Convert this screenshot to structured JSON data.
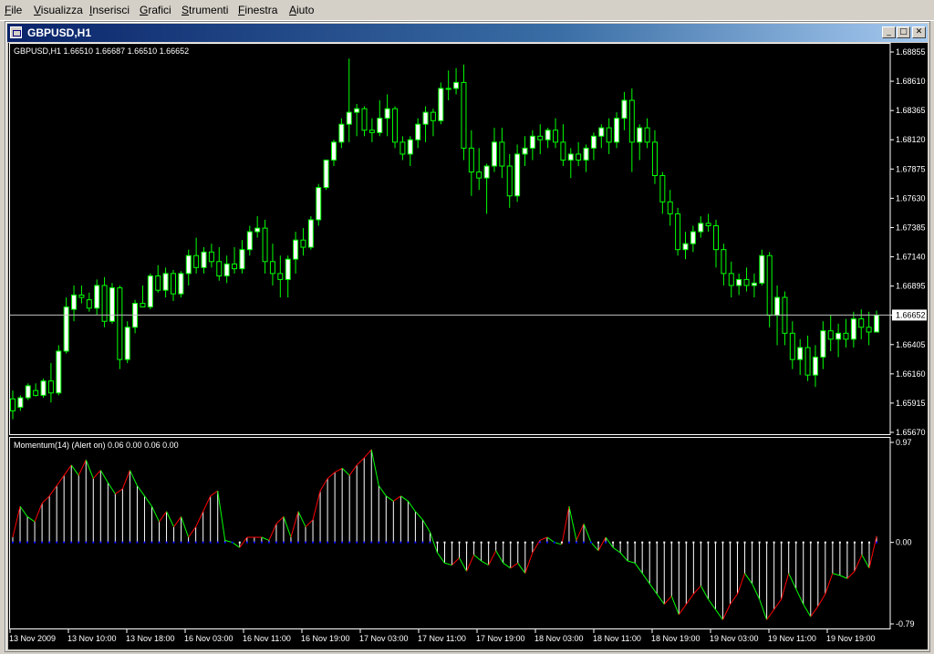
{
  "menu": [
    {
      "label": "File",
      "u": "F",
      "rest": "ile"
    },
    {
      "label": "Visualizza",
      "u": "V",
      "rest": "isualizza"
    },
    {
      "label": "Inserisci",
      "u": "I",
      "rest": "nserisci"
    },
    {
      "label": "Grafici",
      "u": "G",
      "rest": "rafici"
    },
    {
      "label": "Strumenti",
      "u": "S",
      "rest": "trumenti"
    },
    {
      "label": "Finestra",
      "u": "F",
      "rest": "inestra"
    },
    {
      "label": "Aiuto",
      "u": "A",
      "rest": "iuto"
    }
  ],
  "window": {
    "title": "GBPUSD,H1"
  },
  "colors": {
    "bull": "#00ff00",
    "bear": "#000000",
    "candle_outline": "#00ff00",
    "bull_fill": "#ffffff",
    "hline": "#c0c0c0",
    "mom_line_pos": "#ff0000",
    "mom_line_neg": "#00ff00",
    "mom_stick": "#ffffff",
    "mom_dot_pos": "#0000ff",
    "mom_dot_neg": "#ffffff"
  },
  "main_chart": {
    "header": "GBPUSD,H1  1.66510 1.66687 1.66510 1.66652",
    "price_labels": [
      "1.68855",
      "1.68610",
      "1.68365",
      "1.68120",
      "1.67875",
      "1.67630",
      "1.67385",
      "1.67140",
      "1.66895",
      "1.66652",
      "1.66405",
      "1.66160",
      "1.65915",
      "1.65670"
    ],
    "current_price": "1.66652"
  },
  "indicator": {
    "header": "Momentum(14) (Alert on) 0.06 0.00 0.06 0.00",
    "labels": [
      "0.97",
      "0.00",
      "-0.79"
    ]
  },
  "time_labels": [
    "13 Nov 2009",
    "13 Nov 10:00",
    "13 Nov 18:00",
    "16 Nov 03:00",
    "16 Nov 11:00",
    "16 Nov 19:00",
    "17 Nov 03:00",
    "17 Nov 11:00",
    "17 Nov 19:00",
    "18 Nov 03:00",
    "18 Nov 11:00",
    "18 Nov 19:00",
    "19 Nov 03:00",
    "19 Nov 11:00",
    "19 Nov 19:00"
  ],
  "chart_data": {
    "type": "candlestick",
    "symbol": "GBPUSD",
    "timeframe": "H1",
    "ylim": [
      1.6567,
      1.69
    ],
    "candles": [
      [
        1.6595,
        1.6602,
        1.6578,
        1.6585
      ],
      [
        1.6588,
        1.6598,
        1.6585,
        1.6596
      ],
      [
        1.6596,
        1.6608,
        1.6594,
        1.6606
      ],
      [
        1.6602,
        1.6608,
        1.6597,
        1.6598
      ],
      [
        1.6598,
        1.6612,
        1.6596,
        1.661
      ],
      [
        1.661,
        1.6625,
        1.6592,
        1.66
      ],
      [
        1.66,
        1.664,
        1.6598,
        1.6635
      ],
      [
        1.6635,
        1.668,
        1.6633,
        1.6672
      ],
      [
        1.667,
        1.669,
        1.666,
        1.6682
      ],
      [
        1.6682,
        1.669,
        1.6675,
        1.668
      ],
      [
        1.6678,
        1.6684,
        1.6668,
        1.6671
      ],
      [
        1.6671,
        1.6695,
        1.6665,
        1.669
      ],
      [
        1.669,
        1.6697,
        1.6655,
        1.666
      ],
      [
        1.666,
        1.6692,
        1.6658,
        1.6688
      ],
      [
        1.6688,
        1.669,
        1.662,
        1.6628
      ],
      [
        1.6628,
        1.666,
        1.6625,
        1.6655
      ],
      [
        1.6655,
        1.6678,
        1.665,
        1.6675
      ],
      [
        1.6675,
        1.669,
        1.6672,
        1.6672
      ],
      [
        1.6672,
        1.67,
        1.667,
        1.6698
      ],
      [
        1.6698,
        1.6707,
        1.6684,
        1.6686
      ],
      [
        1.6686,
        1.6705,
        1.668,
        1.67
      ],
      [
        1.67,
        1.6703,
        1.6677,
        1.6683
      ],
      [
        1.6683,
        1.6702,
        1.668,
        1.67
      ],
      [
        1.67,
        1.672,
        1.669,
        1.6715
      ],
      [
        1.6715,
        1.673,
        1.67,
        1.6705
      ],
      [
        1.6705,
        1.6722,
        1.67,
        1.6718
      ],
      [
        1.6718,
        1.6725,
        1.6705,
        1.671
      ],
      [
        1.671,
        1.6722,
        1.6694,
        1.6698
      ],
      [
        1.6698,
        1.6715,
        1.6692,
        1.6708
      ],
      [
        1.6708,
        1.6722,
        1.67,
        1.6704
      ],
      [
        1.6704,
        1.6728,
        1.67,
        1.672
      ],
      [
        1.672,
        1.674,
        1.6715,
        1.6735
      ],
      [
        1.6735,
        1.6748,
        1.673,
        1.6738
      ],
      [
        1.6738,
        1.6745,
        1.67,
        1.671
      ],
      [
        1.671,
        1.6725,
        1.669,
        1.67
      ],
      [
        1.67,
        1.6715,
        1.668,
        1.6695
      ],
      [
        1.6695,
        1.6715,
        1.668,
        1.6712
      ],
      [
        1.6712,
        1.6735,
        1.67,
        1.6728
      ],
      [
        1.6728,
        1.6738,
        1.6715,
        1.6722
      ],
      [
        1.6722,
        1.6748,
        1.672,
        1.6745
      ],
      [
        1.6745,
        1.6775,
        1.674,
        1.6772
      ],
      [
        1.6772,
        1.6795,
        1.677,
        1.6795
      ],
      [
        1.6795,
        1.6812,
        1.679,
        1.681
      ],
      [
        1.681,
        1.683,
        1.6805,
        1.6825
      ],
      [
        1.6825,
        1.688,
        1.681,
        1.6835
      ],
      [
        1.6835,
        1.6842,
        1.6815,
        1.6838
      ],
      [
        1.6838,
        1.684,
        1.6815,
        1.682
      ],
      [
        1.682,
        1.683,
        1.681,
        1.6818
      ],
      [
        1.6818,
        1.6845,
        1.6815,
        1.683
      ],
      [
        1.683,
        1.685,
        1.6815,
        1.6838
      ],
      [
        1.6838,
        1.684,
        1.6805,
        1.681
      ],
      [
        1.681,
        1.6815,
        1.6795,
        1.68
      ],
      [
        1.68,
        1.6815,
        1.679,
        1.6812
      ],
      [
        1.6812,
        1.683,
        1.6805,
        1.6825
      ],
      [
        1.6825,
        1.684,
        1.681,
        1.6835
      ],
      [
        1.6835,
        1.6838,
        1.6815,
        1.6828
      ],
      [
        1.6828,
        1.686,
        1.6825,
        1.6855
      ],
      [
        1.6855,
        1.687,
        1.6845,
        1.6855
      ],
      [
        1.6855,
        1.6872,
        1.685,
        1.686
      ],
      [
        1.686,
        1.6875,
        1.6795,
        1.6805
      ],
      [
        1.6805,
        1.682,
        1.6765,
        1.6785
      ],
      [
        1.6785,
        1.6805,
        1.677,
        1.678
      ],
      [
        1.678,
        1.6792,
        1.675,
        1.679
      ],
      [
        1.679,
        1.6822,
        1.6785,
        1.681
      ],
      [
        1.681,
        1.6822,
        1.678,
        1.679
      ],
      [
        1.679,
        1.68,
        1.6755,
        1.6765
      ],
      [
        1.6765,
        1.6808,
        1.676,
        1.68
      ],
      [
        1.68,
        1.6815,
        1.679,
        1.6805
      ],
      [
        1.6805,
        1.682,
        1.6795,
        1.6815
      ],
      [
        1.6815,
        1.6825,
        1.68,
        1.6812
      ],
      [
        1.6812,
        1.6822,
        1.6805,
        1.682
      ],
      [
        1.682,
        1.683,
        1.6805,
        1.681
      ],
      [
        1.681,
        1.6825,
        1.679,
        1.6795
      ],
      [
        1.6795,
        1.6805,
        1.678,
        1.68
      ],
      [
        1.68,
        1.681,
        1.679,
        1.6795
      ],
      [
        1.6795,
        1.6808,
        1.6785,
        1.6805
      ],
      [
        1.6805,
        1.6818,
        1.6795,
        1.6815
      ],
      [
        1.6815,
        1.6825,
        1.6805,
        1.6822
      ],
      [
        1.6822,
        1.683,
        1.68,
        1.681
      ],
      [
        1.681,
        1.6835,
        1.6805,
        1.683
      ],
      [
        1.683,
        1.6852,
        1.682,
        1.6845
      ],
      [
        1.6845,
        1.6855,
        1.6785,
        1.681
      ],
      [
        1.681,
        1.6825,
        1.6795,
        1.6822
      ],
      [
        1.6822,
        1.683,
        1.6805,
        1.681
      ],
      [
        1.681,
        1.682,
        1.6775,
        1.6782
      ],
      [
        1.6782,
        1.6785,
        1.675,
        1.676
      ],
      [
        1.676,
        1.677,
        1.674,
        1.675
      ],
      [
        1.675,
        1.6755,
        1.6715,
        1.672
      ],
      [
        1.672,
        1.6735,
        1.6712,
        1.6725
      ],
      [
        1.6725,
        1.674,
        1.6718,
        1.6735
      ],
      [
        1.6735,
        1.6748,
        1.673,
        1.6742
      ],
      [
        1.6742,
        1.675,
        1.6735,
        1.674
      ],
      [
        1.674,
        1.6745,
        1.6705,
        1.672
      ],
      [
        1.672,
        1.6725,
        1.669,
        1.67
      ],
      [
        1.67,
        1.671,
        1.668,
        1.669
      ],
      [
        1.669,
        1.67,
        1.6682,
        1.6695
      ],
      [
        1.6695,
        1.6705,
        1.6685,
        1.669
      ],
      [
        1.669,
        1.67,
        1.668,
        1.6692
      ],
      [
        1.6692,
        1.672,
        1.669,
        1.6715
      ],
      [
        1.6715,
        1.6718,
        1.6655,
        1.6665
      ],
      [
        1.6665,
        1.669,
        1.664,
        1.668
      ],
      [
        1.668,
        1.6685,
        1.664,
        1.665
      ],
      [
        1.665,
        1.666,
        1.662,
        1.6628
      ],
      [
        1.6628,
        1.6645,
        1.6615,
        1.6638
      ],
      [
        1.6638,
        1.6648,
        1.661,
        1.6615
      ],
      [
        1.6615,
        1.664,
        1.6605,
        1.663
      ],
      [
        1.663,
        1.666,
        1.662,
        1.6652
      ],
      [
        1.6652,
        1.6665,
        1.6635,
        1.6645
      ],
      [
        1.6645,
        1.6658,
        1.663,
        1.665
      ],
      [
        1.665,
        1.6662,
        1.6638,
        1.6645
      ],
      [
        1.6645,
        1.6668,
        1.6638,
        1.6662
      ],
      [
        1.6662,
        1.667,
        1.6645,
        1.6655
      ],
      [
        1.6655,
        1.6668,
        1.664,
        1.6651
      ],
      [
        1.6651,
        1.6669,
        1.6651,
        1.6665
      ]
    ],
    "momentum": {
      "name": "Momentum(14)",
      "ylim": [
        -0.79,
        0.97
      ],
      "values": [
        0.05,
        0.35,
        0.25,
        0.2,
        0.38,
        0.45,
        0.55,
        0.65,
        0.75,
        0.65,
        0.8,
        0.62,
        0.7,
        0.58,
        0.47,
        0.52,
        0.7,
        0.55,
        0.45,
        0.35,
        0.2,
        0.3,
        0.15,
        0.25,
        0.05,
        0.15,
        0.3,
        0.45,
        0.5,
        0.02,
        0.0,
        -0.05,
        0.05,
        0.05,
        0.05,
        0.02,
        0.18,
        0.25,
        0.05,
        0.3,
        0.15,
        0.22,
        0.5,
        0.62,
        0.68,
        0.72,
        0.65,
        0.75,
        0.82,
        0.9,
        0.55,
        0.45,
        0.4,
        0.45,
        0.4,
        0.3,
        0.22,
        0.1,
        -0.1,
        -0.2,
        -0.22,
        -0.15,
        -0.28,
        -0.12,
        -0.18,
        -0.22,
        -0.08,
        -0.2,
        -0.25,
        -0.2,
        -0.3,
        -0.1,
        0.02,
        0.05,
        0.0,
        -0.02,
        0.35,
        0.02,
        0.18,
        0.0,
        -0.08,
        0.05,
        -0.05,
        -0.1,
        -0.18,
        -0.2,
        -0.3,
        -0.4,
        -0.5,
        -0.6,
        -0.52,
        -0.7,
        -0.6,
        -0.5,
        -0.42,
        -0.55,
        -0.65,
        -0.75,
        -0.6,
        -0.5,
        -0.3,
        -0.4,
        -0.55,
        -0.75,
        -0.65,
        -0.55,
        -0.3,
        -0.45,
        -0.6,
        -0.72,
        -0.62,
        -0.5,
        -0.3,
        -0.32,
        -0.35,
        -0.28,
        -0.12,
        -0.25,
        0.06
      ]
    }
  }
}
